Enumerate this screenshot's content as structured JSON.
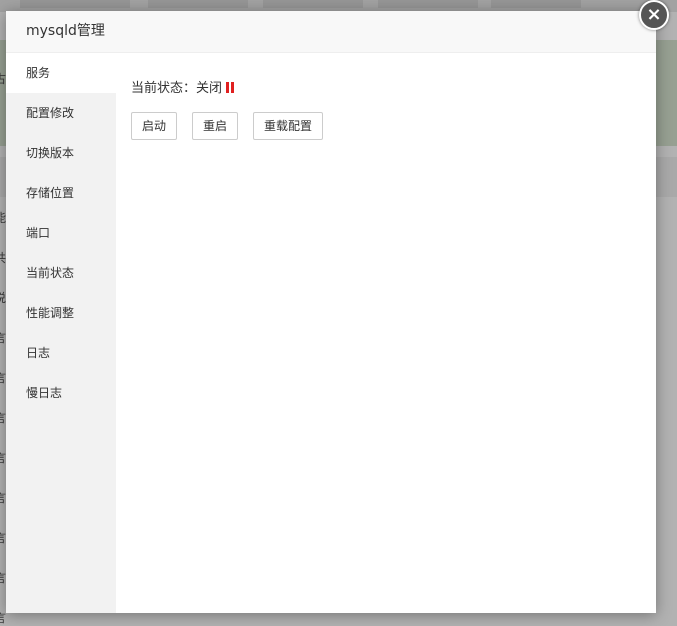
{
  "modal": {
    "title": "mysqld管理",
    "close_symbol": "×"
  },
  "sidebar": {
    "items": [
      {
        "label": "服务",
        "active": true
      },
      {
        "label": "配置修改"
      },
      {
        "label": "切换版本"
      },
      {
        "label": "存储位置"
      },
      {
        "label": "端口"
      },
      {
        "label": "当前状态"
      },
      {
        "label": "性能调整"
      },
      {
        "label": "日志"
      },
      {
        "label": "慢日志"
      }
    ]
  },
  "service": {
    "status_label": "当前状态：",
    "status_value": "关闭",
    "status_color": "#e02020",
    "status_icon": "pause-icon",
    "buttons": {
      "start": "启动",
      "restart": "重启",
      "reload": "重载配置"
    }
  },
  "background": {
    "fragments": [
      "古",
      "能",
      "共",
      "说",
      "言",
      "言",
      "言",
      "言",
      "言",
      "言",
      "言",
      "言"
    ]
  }
}
